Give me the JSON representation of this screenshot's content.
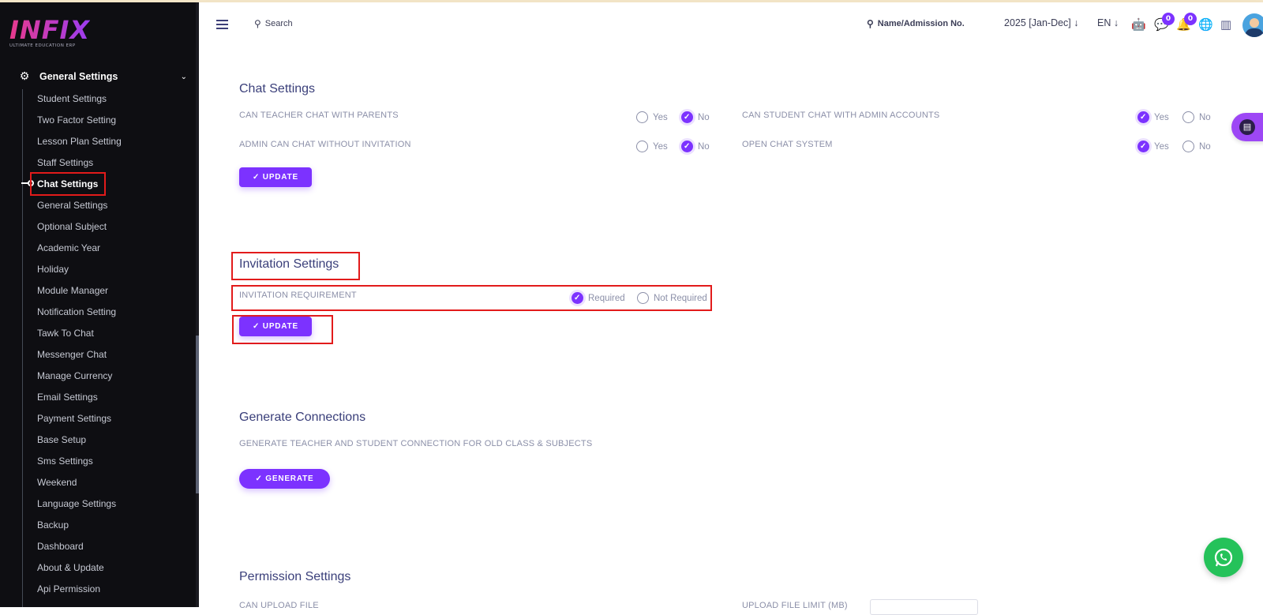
{
  "logo": {
    "text": "INFIX",
    "subtitle": "ULTIMATE EDUCATION ERP"
  },
  "sidebar": {
    "section_label": "General Settings",
    "items": [
      {
        "label": "Student Settings"
      },
      {
        "label": "Two Factor Setting"
      },
      {
        "label": "Lesson Plan Setting"
      },
      {
        "label": "Staff Settings"
      },
      {
        "label": "Chat Settings",
        "active": true
      },
      {
        "label": "General Settings"
      },
      {
        "label": "Optional Subject"
      },
      {
        "label": "Academic Year"
      },
      {
        "label": "Holiday"
      },
      {
        "label": "Module Manager"
      },
      {
        "label": "Notification Setting"
      },
      {
        "label": "Tawk To Chat"
      },
      {
        "label": "Messenger Chat"
      },
      {
        "label": "Manage Currency"
      },
      {
        "label": "Email Settings"
      },
      {
        "label": "Payment Settings"
      },
      {
        "label": "Base Setup"
      },
      {
        "label": "Sms Settings"
      },
      {
        "label": "Weekend"
      },
      {
        "label": "Language Settings"
      },
      {
        "label": "Backup"
      },
      {
        "label": "Dashboard"
      },
      {
        "label": "About & Update"
      },
      {
        "label": "Api Permission"
      }
    ]
  },
  "header": {
    "search_label": "Search",
    "admission_search_label": "Name/Admission No.",
    "academic_year": "2025 [Jan-Dec]",
    "language": "EN",
    "chat_badge": "0",
    "notification_badge": "0",
    "icons": [
      "menu-icon",
      "search-icon",
      "robot-icon",
      "chat-icon",
      "bell-icon",
      "globe-icon",
      "analytics-icon"
    ]
  },
  "chat_settings": {
    "title": "Chat Settings",
    "teacher_parents": {
      "label": "CAN TEACHER CHAT WITH PARENTS",
      "yes": "Yes",
      "no": "No",
      "selected": "No"
    },
    "student_admin": {
      "label": "CAN STUDENT CHAT WITH ADMIN ACCOUNTS",
      "yes": "Yes",
      "no": "No",
      "selected": "Yes"
    },
    "admin_without_invite": {
      "label": "ADMIN CAN CHAT WITHOUT INVITATION",
      "yes": "Yes",
      "no": "No",
      "selected": "No"
    },
    "open_chat": {
      "label": "OPEN CHAT SYSTEM",
      "yes": "Yes",
      "no": "No",
      "selected": "Yes"
    },
    "update_label": "UPDATE"
  },
  "invitation_settings": {
    "title": "Invitation Settings",
    "requirement_label": "INVITATION REQUIREMENT",
    "required": "Required",
    "not_required": "Not Required",
    "selected": "Required",
    "update_label": "UPDATE"
  },
  "generate_connections": {
    "title": "Generate Connections",
    "description": "GENERATE TEACHER AND STUDENT CONNECTION FOR OLD CLASS & SUBJECTS",
    "button_label": "GENERATE"
  },
  "permission_settings": {
    "title": "Permission Settings",
    "can_upload_label": "CAN UPLOAD FILE",
    "upload_limit_label": "UPLOAD FILE LIMIT (MB)"
  },
  "colors": {
    "accent": "#7c32ff",
    "highlight": "#e21b1b",
    "sidebar_bg": "#0e0e12",
    "whatsapp": "#25c25a"
  }
}
